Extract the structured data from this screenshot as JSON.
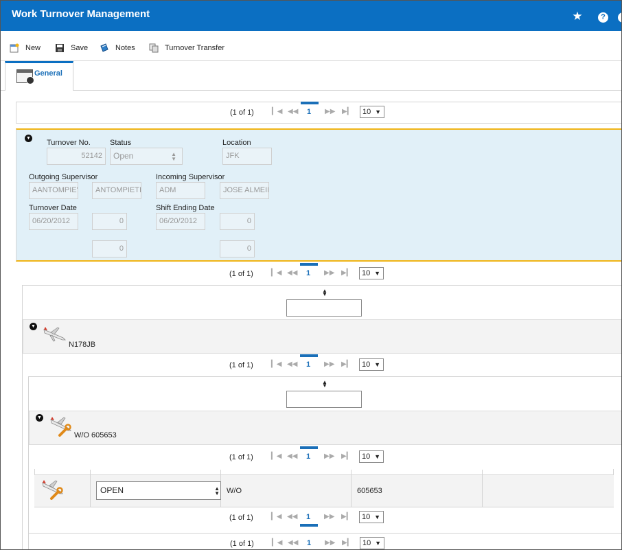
{
  "header": {
    "title": "Work Turnover Management"
  },
  "icons": {
    "favorite": "star-icon",
    "help": "help-icon",
    "user": "user-icon"
  },
  "toolbar": {
    "new_label": "New",
    "save_label": "Save",
    "notes_label": "Notes",
    "transfer_label": "Turnover Transfer"
  },
  "tabs": [
    {
      "label": "General"
    }
  ],
  "pager": {
    "count": "(1 of 1)",
    "page": "1",
    "page_size": "10"
  },
  "turnover": {
    "labels": {
      "turnover_no": "Turnover No.",
      "status": "Status",
      "location": "Location",
      "outgoing_supervisor": "Outgoing Supervisor",
      "incoming_supervisor": "Incoming Supervisor",
      "turnover_date": "Turnover Date",
      "shift_ending_date": "Shift Ending Date"
    },
    "values": {
      "turnover_no": "52142",
      "status": "Open",
      "location": "JFK",
      "outgoing_code": "AANTOMPIE'",
      "outgoing_name": "ANTOMPIETI",
      "incoming_code": "ADM",
      "incoming_name": "JOSE ALMEII",
      "turnover_date": "06/20/2012",
      "turnover_hour": "0",
      "turnover_minute": "0",
      "shift_ending_date": "06/20/2012",
      "shift_hour": "0",
      "shift_minute": "0"
    }
  },
  "aircraft": {
    "label": "N178JB"
  },
  "work_order_group": {
    "label": "W/O 605653"
  },
  "work_order_row": {
    "status": "OPEN",
    "type": "W/O",
    "number": "605653"
  },
  "colors": {
    "brand": "#0b6fc2",
    "selection_border": "#f0b414",
    "panel_bg": "#e1f0f8"
  }
}
